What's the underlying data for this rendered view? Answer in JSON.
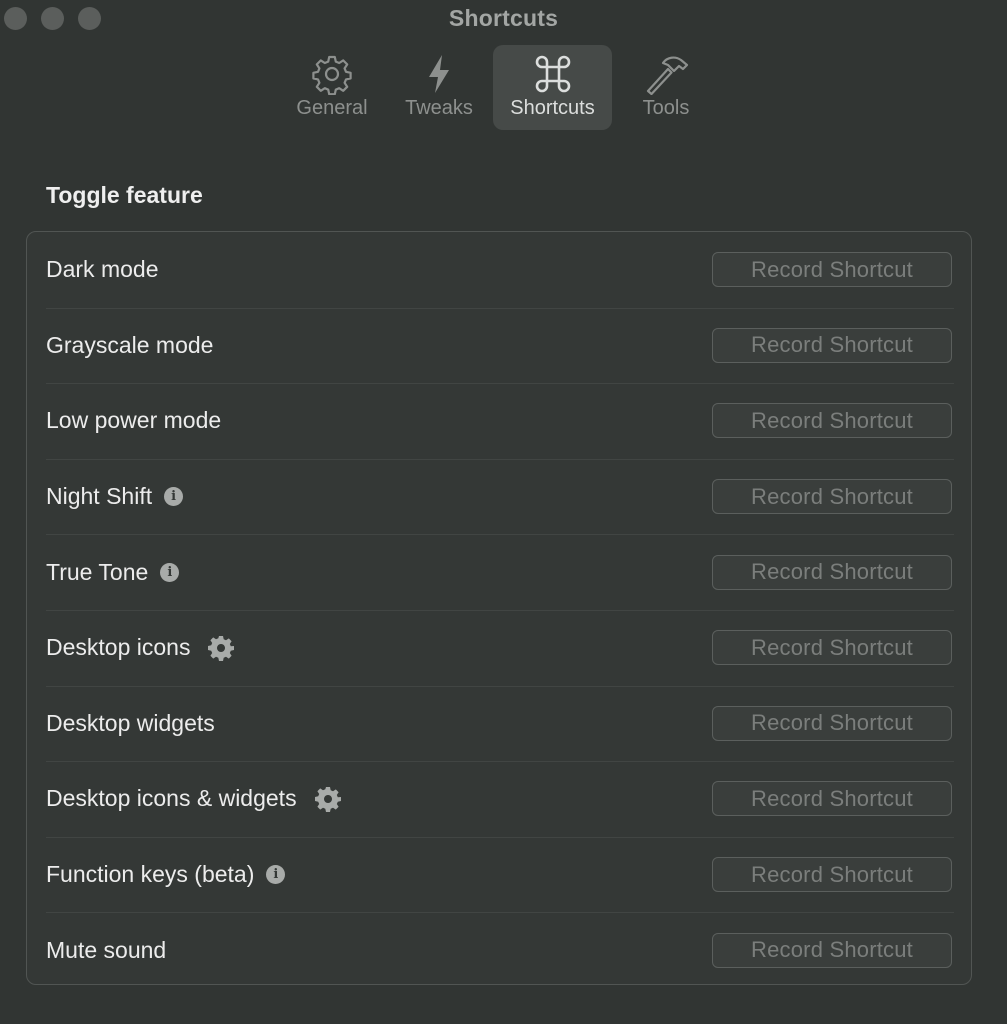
{
  "window": {
    "title": "Shortcuts"
  },
  "tabs": [
    {
      "label": "General",
      "icon": "gear-icon",
      "active": false
    },
    {
      "label": "Tweaks",
      "icon": "lightning-bolt-icon",
      "active": false
    },
    {
      "label": "Shortcuts",
      "icon": "command-key-icon",
      "active": true
    },
    {
      "label": "Tools",
      "icon": "hammer-icon",
      "active": false
    }
  ],
  "section": {
    "title": "Toggle feature"
  },
  "rows": [
    {
      "label": "Dark mode",
      "button": "Record Shortcut"
    },
    {
      "label": "Grayscale mode",
      "button": "Record Shortcut"
    },
    {
      "label": "Low power mode",
      "button": "Record Shortcut"
    },
    {
      "label": "Night Shift",
      "icon": "info-icon",
      "button": "Record Shortcut"
    },
    {
      "label": "True Tone",
      "icon": "info-icon",
      "button": "Record Shortcut"
    },
    {
      "label": "Desktop icons",
      "icon": "gear-icon",
      "button": "Record Shortcut"
    },
    {
      "label": "Desktop widgets",
      "button": "Record Shortcut"
    },
    {
      "label": "Desktop icons & widgets",
      "icon": "gear-icon",
      "button": "Record Shortcut"
    },
    {
      "label": "Function keys (beta)",
      "icon": "info-icon",
      "button": "Record Shortcut"
    },
    {
      "label": "Mute sound",
      "button": "Record Shortcut"
    }
  ],
  "colors": {
    "background": "#313533",
    "active_tab": "#464a48",
    "panel_border": "#515553"
  }
}
